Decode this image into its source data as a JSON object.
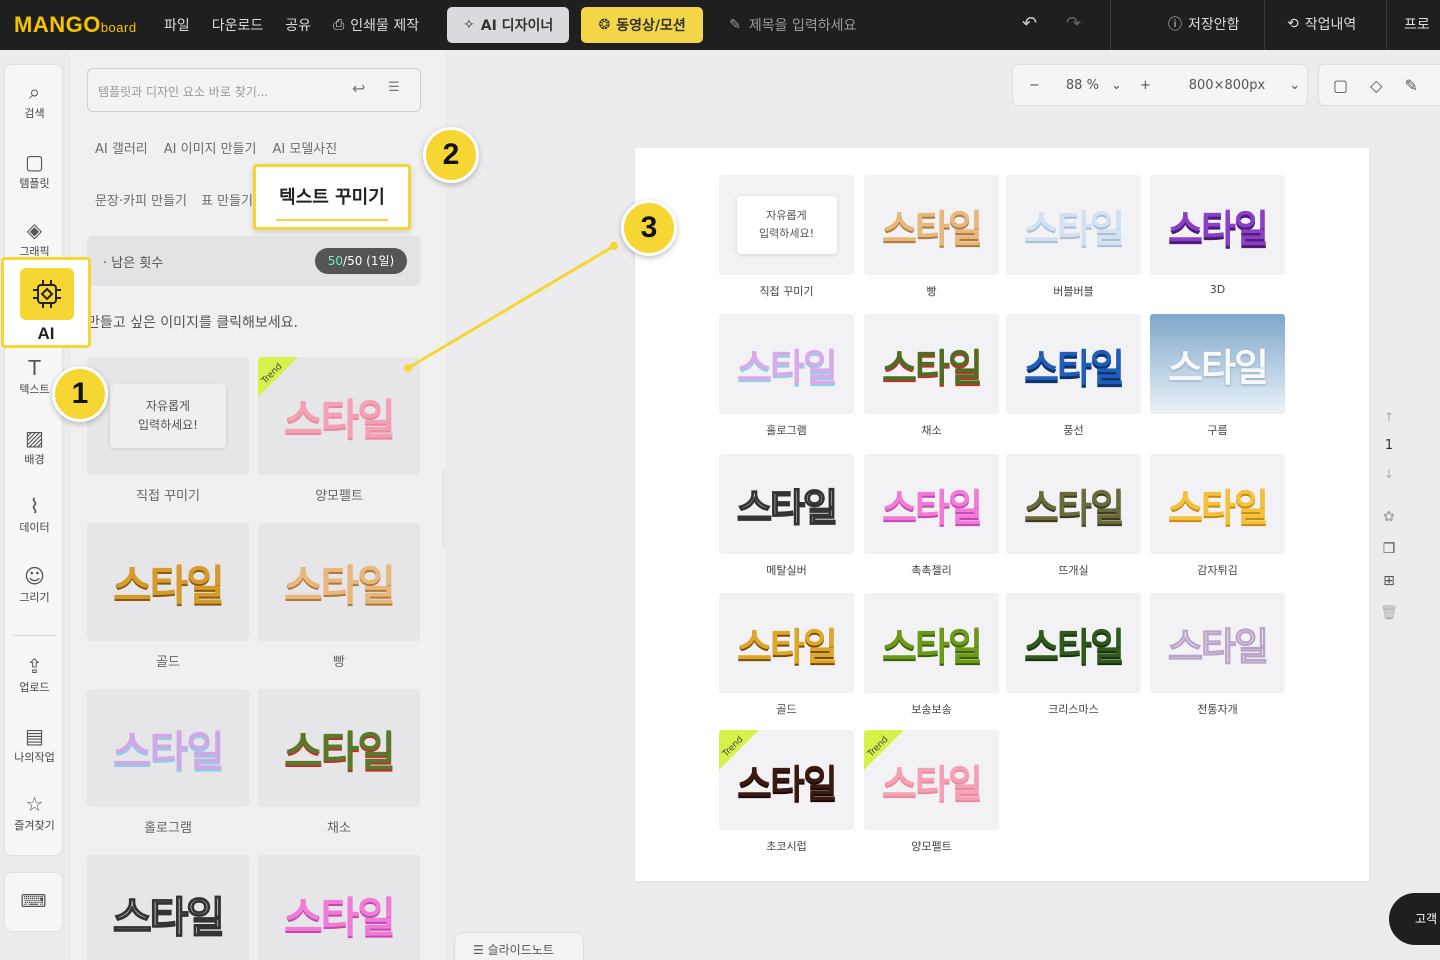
{
  "header": {
    "logo": "MANGO",
    "logo_suffix": "board",
    "menu": [
      "파일",
      "다운로드",
      "공유"
    ],
    "print_label": "인쇄물 제작",
    "ai_designer": "AI 디자이너",
    "video": "동영상/모션",
    "title_placeholder": "제목을 입력하세요",
    "save_status": "저장안함",
    "history": "작업내역",
    "profile": "프로"
  },
  "rail": {
    "items": [
      "검색",
      "템플릿",
      "그래픽",
      "텍스트",
      "배경",
      "데이터",
      "그리기",
      "업로드",
      "나의작업",
      "즐겨찾기"
    ],
    "ai_label": "AI"
  },
  "panel": {
    "search_placeholder": "템플릿과 디자인 요소 바로 찾기...",
    "tabs_row1": [
      "AI 갤러리",
      "AI 이미지 만들기",
      "AI 모델사진"
    ],
    "tabs_row2": [
      "문장·카피 만들기",
      "표 만들기"
    ],
    "remain_label": "· 남은 횟수",
    "remain_used": "50",
    "remain_rest": "/50 (1일)",
    "hint": "만들고 싶은 이미지를 클릭해보세요.",
    "free_text_line1": "자유롭게",
    "free_text_line2": "입력하세요!",
    "trend": "Trend",
    "sample_word": "스타일",
    "cards": [
      "직접 꾸미기",
      "양모펠트",
      "골드",
      "빵",
      "홀로그램",
      "채소",
      "",
      ""
    ]
  },
  "callouts": {
    "n1": "1",
    "n2": "2",
    "n3": "3",
    "text_decorate": "텍스트 꾸미기"
  },
  "canvas": {
    "zoom": "88 %",
    "size": "800×800px",
    "page_number": "1",
    "slide_note": "슬라이드노트",
    "chat": "고객",
    "tiles": [
      "직접 꾸미기",
      "빵",
      "버블버블",
      "3D",
      "홀로그램",
      "채소",
      "풍선",
      "구름",
      "메탈실버",
      "촉촉젤리",
      "뜨개실",
      "감자튀김",
      "골드",
      "보송보송",
      "크리스마스",
      "전통자개",
      "초코시럽",
      "양모펠트"
    ]
  },
  "colors": {
    "accent": "#f5d632",
    "topbar": "#1f1f1f",
    "trend": "#d7f24b"
  }
}
